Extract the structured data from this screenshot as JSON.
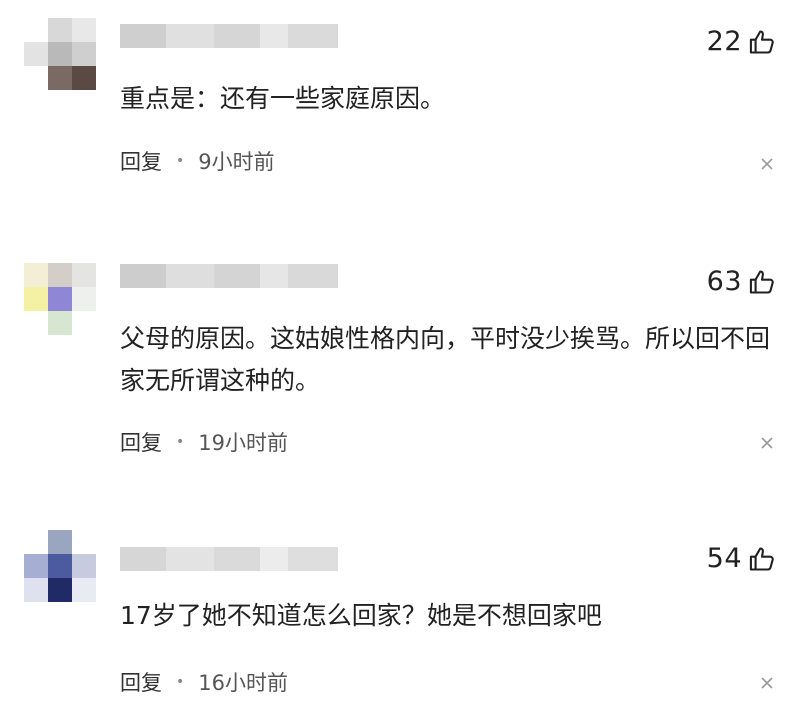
{
  "comments": [
    {
      "likes": "22",
      "text": "重点是：还有一些家庭原因。",
      "reply": "回复",
      "time": "9小时前"
    },
    {
      "likes": "63",
      "text": "父母的原因。这姑娘性格内向，平时没少挨骂。所以回不回家无所谓这种的。",
      "reply": "回复",
      "time": "19小时前"
    },
    {
      "likes": "54",
      "text": "17岁了她不知道怎么回家？她是不想回家吧",
      "reply": "回复",
      "time": "16小时前"
    }
  ],
  "icons": {
    "like": "thumbs-up-icon",
    "close": "close-icon"
  }
}
